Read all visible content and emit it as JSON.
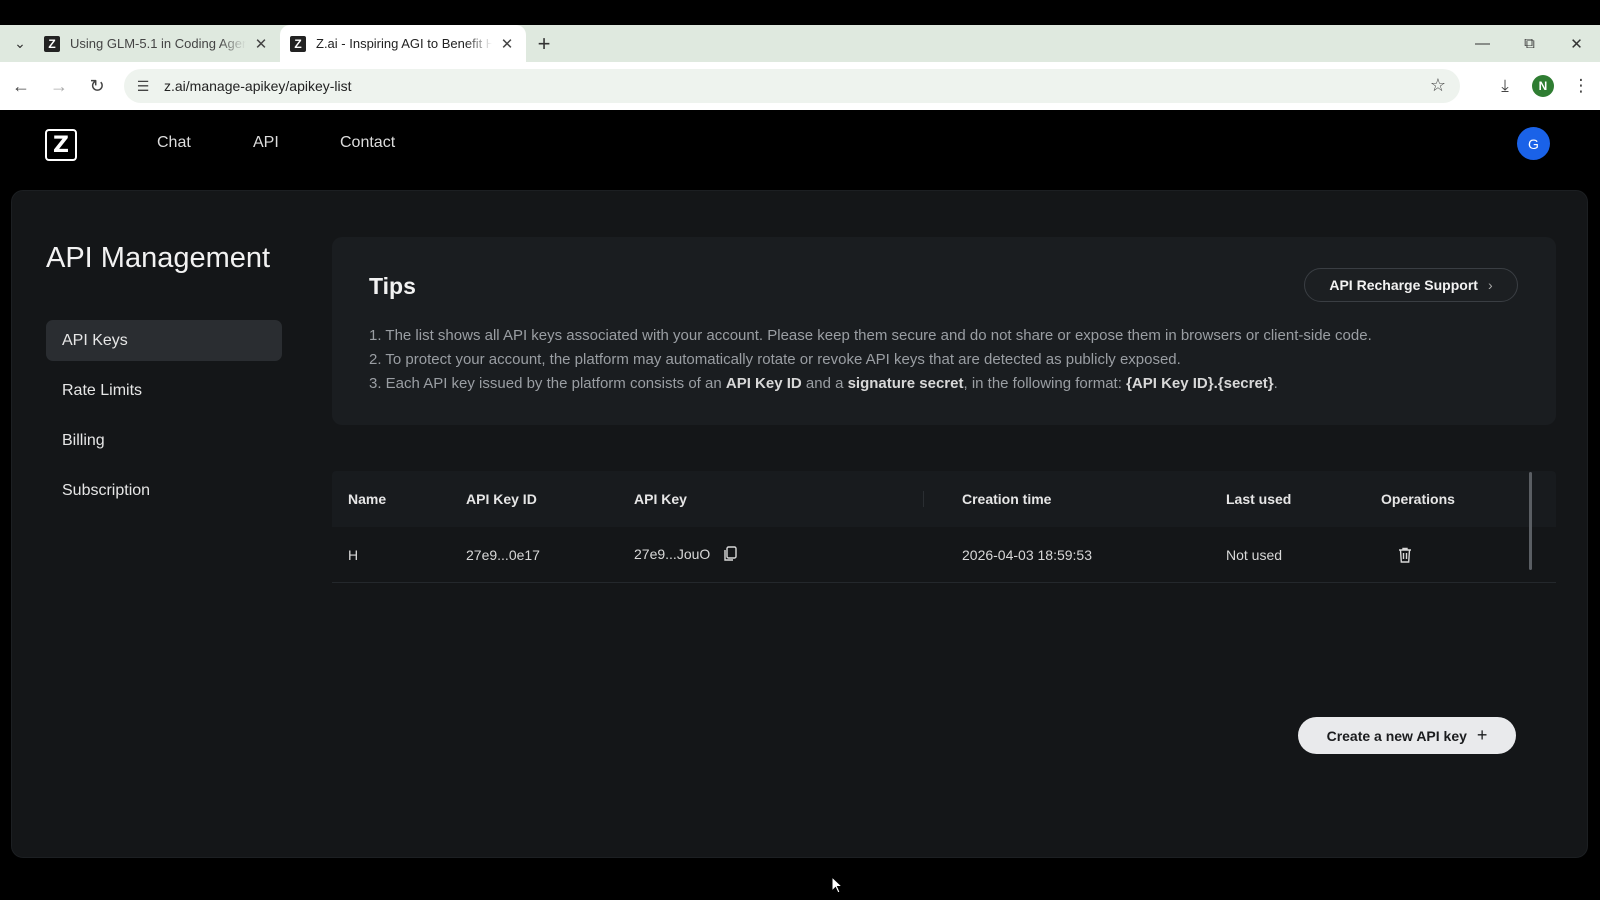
{
  "browser": {
    "tabs": [
      {
        "title": "Using GLM-5.1 in Coding Agent",
        "active": false
      },
      {
        "title": "Z.ai - Inspiring AGI to Benefit Humanity",
        "active": true
      }
    ],
    "url": "z.ai/manage-apikey/apikey-list",
    "profile_initial": "N"
  },
  "app": {
    "logo_letter": "Z",
    "nav": [
      "Chat",
      "API",
      "Contact"
    ],
    "avatar_initial": "G"
  },
  "page": {
    "title": "API Management",
    "sidebar": [
      {
        "label": "API Keys",
        "active": true
      },
      {
        "label": "Rate Limits",
        "active": false
      },
      {
        "label": "Billing",
        "active": false
      },
      {
        "label": "Subscription",
        "active": false
      }
    ]
  },
  "tips": {
    "title": "Tips",
    "recharge_button": "API Recharge Support",
    "line1": "1. The list shows all API keys associated with your account. Please keep them secure and do not share or expose them in browsers or client-side code.",
    "line2": "2. To protect your account, the platform may automatically rotate or revoke API keys that are detected as publicly exposed.",
    "line3_parts": {
      "a": "3. Each API key issued by the platform consists of an ",
      "b": "API Key ID",
      "c": " and a ",
      "d": "signature secret",
      "e": ", in the following format: ",
      "f": "{API Key ID}.{secret}",
      "g": "."
    }
  },
  "table": {
    "headers": {
      "name": "Name",
      "key_id": "API Key ID",
      "key": "API Key",
      "created": "Creation time",
      "last_used": "Last used",
      "operations": "Operations"
    },
    "rows": [
      {
        "name": "H",
        "key_id": "27e9...0e17",
        "key": "27e9...JouO",
        "created": "2026-04-03 18:59:53",
        "last_used": "Not used"
      }
    ]
  },
  "create_button": "Create a new API key",
  "colors": {
    "accent_avatar": "#1a62e8",
    "panel_bg": "#141618"
  }
}
